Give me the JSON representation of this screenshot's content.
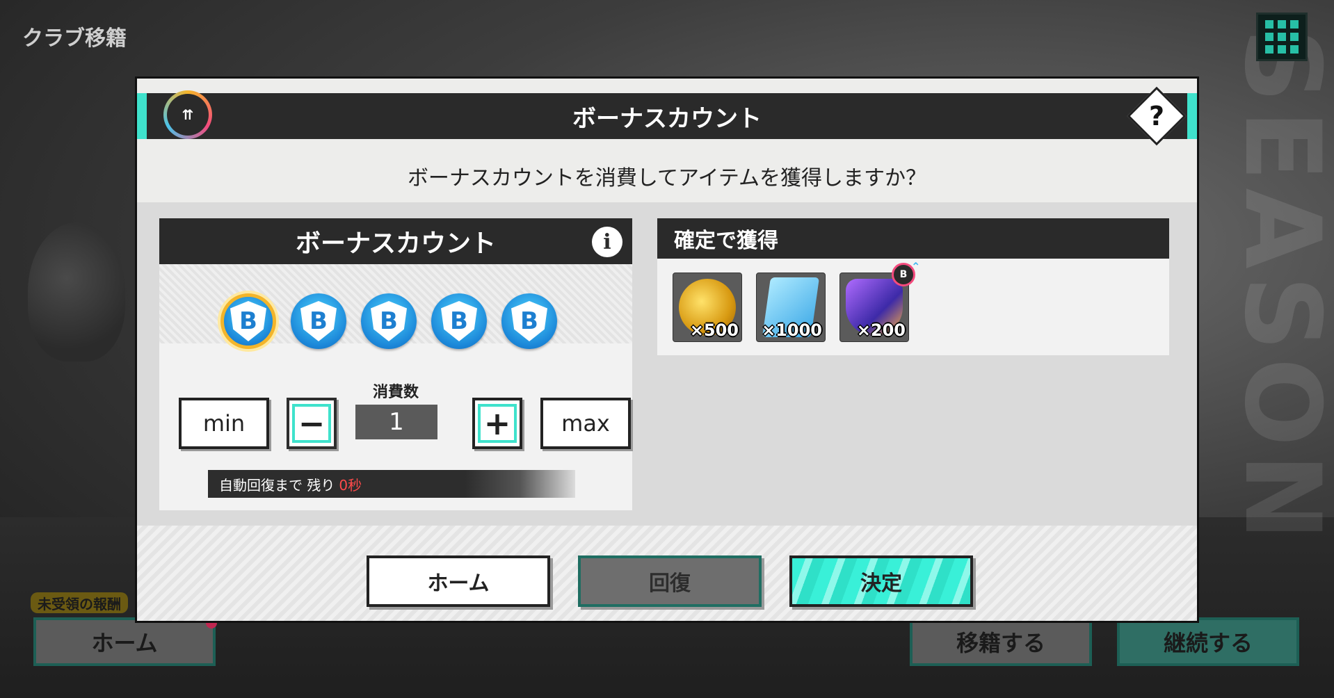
{
  "screen": {
    "title": "クラブ移籍"
  },
  "background_buttons": {
    "home": "ホーム",
    "transfer": "移籍する",
    "continue": "継続する",
    "reward_tag": "未受領の報酬"
  },
  "modal": {
    "title": "ボーナスカウント",
    "help_icon": "?",
    "question": "ボーナスカウントを消費してアイテムを獲得しますか？",
    "bonus_panel": {
      "title": "ボーナスカウント",
      "info_icon": "i",
      "coin_letter": "B",
      "coins_total": 5,
      "qty_label": "消費数",
      "min_label": "min",
      "minus_label": "−",
      "qty_value": "1",
      "plus_label": "+",
      "max_label": "max",
      "recovery_text": "自動回復まで 残り",
      "recovery_time": "0秒"
    },
    "reward_panel": {
      "title": "確定で獲得",
      "items": [
        {
          "icon": "player-coin-icon",
          "count": "×500"
        },
        {
          "icon": "training-card-icon",
          "count": "×1000"
        },
        {
          "icon": "shield-badge-icon",
          "count": "×200"
        }
      ],
      "boost_badge": "B"
    },
    "buttons": {
      "home": "ホーム",
      "recover": "回復",
      "confirm": "決定"
    }
  },
  "colors": {
    "accent": "#3fe2cc",
    "header_bg": "#2a2a2a",
    "coin_blue": "#1b86d8",
    "coin_active_ring": "#f3b52a",
    "timer_red": "#ff4a4a"
  }
}
